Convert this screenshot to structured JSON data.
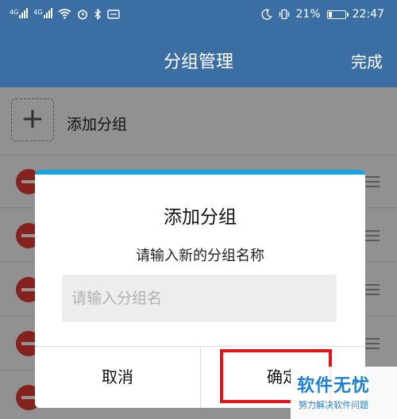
{
  "status_bar": {
    "network_tag": "4G",
    "battery_percent": "21%",
    "battery_level": 0.21,
    "time": "22:47"
  },
  "header": {
    "title": "分组管理",
    "done_label": "完成"
  },
  "list": {
    "add_label": "添加分组",
    "last_visible_item_label": "@@"
  },
  "dialog": {
    "title": "添加分组",
    "subtitle": "请输入新的分组名称",
    "input_value": "",
    "input_placeholder": "请输入分组名",
    "cancel_label": "取消",
    "confirm_label": "确定"
  },
  "watermark": {
    "logo": "软件无忧",
    "tagline": "努力解决软件问题"
  },
  "colors": {
    "header_bg": "#3b6fa3",
    "dialog_accent": "#1aa1e0",
    "delete_red": "#e53935",
    "highlight_red": "#e5131a",
    "watermark_blue": "#1e7fd2"
  }
}
